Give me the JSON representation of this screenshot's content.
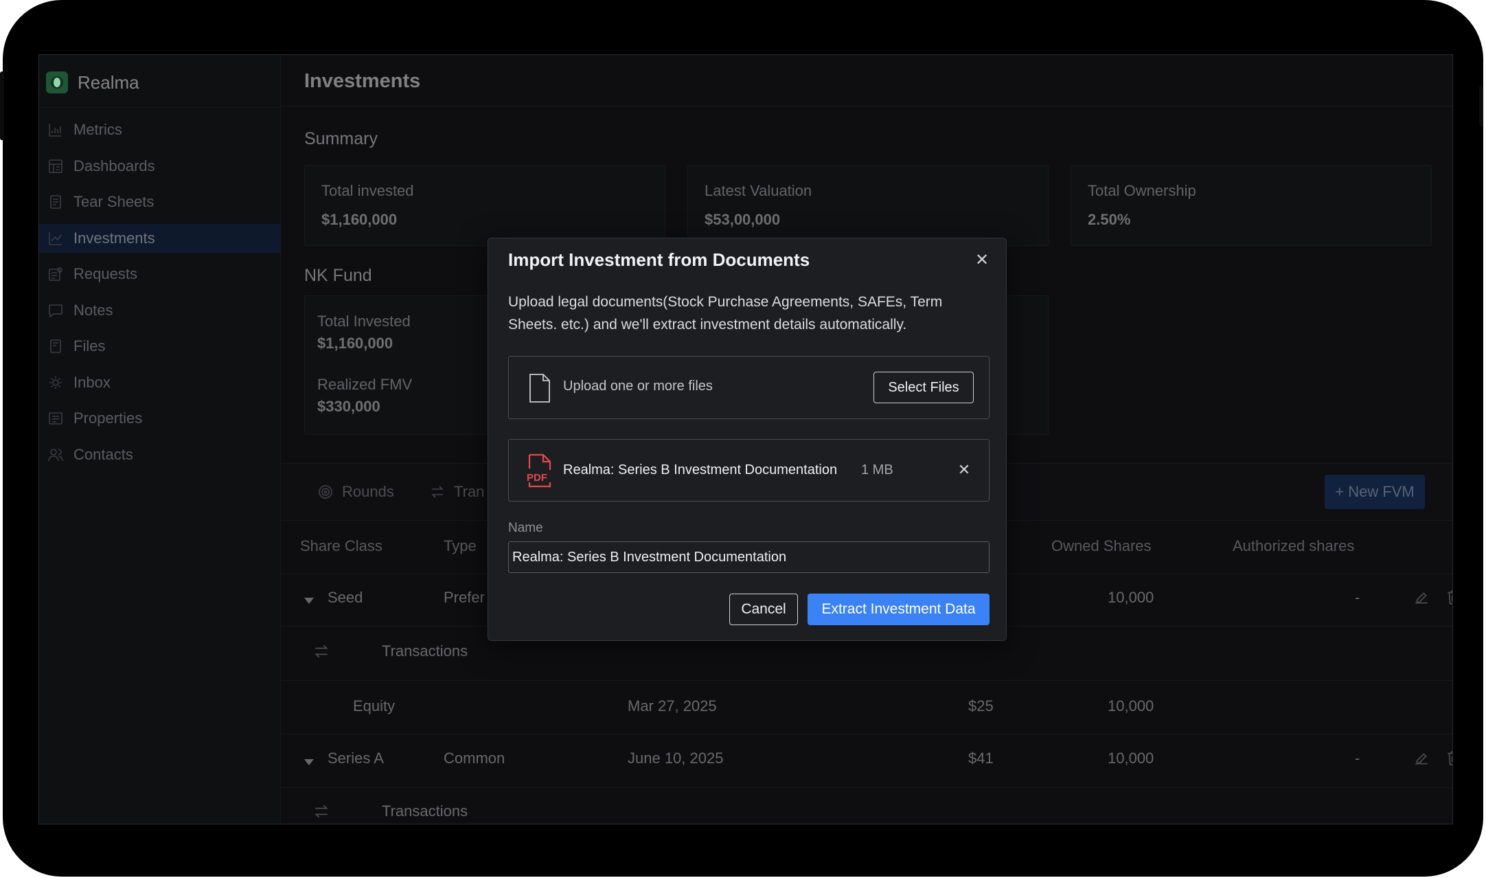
{
  "app": {
    "name": "Realma"
  },
  "sidebar": {
    "items": [
      {
        "label": "Metrics",
        "icon": "bar-chart-icon"
      },
      {
        "label": "Dashboards",
        "icon": "dashboard-icon"
      },
      {
        "label": "Tear Sheets",
        "icon": "document-icon"
      },
      {
        "label": "Investments",
        "icon": "line-chart-icon",
        "active": true
      },
      {
        "label": "Requests",
        "icon": "request-icon"
      },
      {
        "label": "Notes",
        "icon": "chat-bubble-icon"
      },
      {
        "label": "Files",
        "icon": "file-icon"
      },
      {
        "label": "Inbox",
        "icon": "inbox-icon"
      },
      {
        "label": "Properties",
        "icon": "list-icon"
      },
      {
        "label": "Contacts",
        "icon": "users-icon"
      }
    ]
  },
  "page": {
    "title": "Investments"
  },
  "summary": {
    "title": "Summary",
    "cards": [
      {
        "label": "Total invested",
        "value": "$1,160,000"
      },
      {
        "label": "Latest Valuation",
        "value": "$53,00,000"
      },
      {
        "label": "Total Ownership",
        "value": "2.50%"
      }
    ]
  },
  "fund": {
    "title": "NK Fund",
    "total_invested_label": "Total Invested",
    "total_invested_value": "$1,160,000",
    "realized_fmv_label": "Realized FMV",
    "realized_fmv_value": "$330,000"
  },
  "tabs": [
    {
      "label": "Rounds",
      "icon": "target-icon"
    },
    {
      "label": "Tran",
      "icon": "swap-icon"
    }
  ],
  "new_fvm_label": "+ New FVM",
  "table": {
    "headers": {
      "share_class": "Share Class",
      "type": "Type",
      "owned_shares": "Owned Shares",
      "authorized_shares": "Authorized shares"
    },
    "rows": [
      {
        "share_class": "Seed",
        "type": "Prefer",
        "owned_shares": "10,000",
        "authorized": "-"
      },
      {
        "transactions_label": "Transactions"
      },
      {
        "share_class": "Equity",
        "date": "Mar 27, 2025",
        "price": "$25",
        "owned_shares": "10,000"
      },
      {
        "share_class": "Series A",
        "type": "Common",
        "date": "June 10, 2025",
        "price": "$41",
        "owned_shares": "10,000",
        "authorized": "-"
      },
      {
        "transactions_label": "Transactions"
      }
    ]
  },
  "modal": {
    "title": "Import Investment from Documents",
    "description": "Upload legal documents(Stock Purchase Agreements, SAFEs, Term Sheets. etc.) and we'll extract investment details automatically.",
    "upload_text": "Upload one or more files",
    "select_files_label": "Select Files",
    "file": {
      "name": "Realma: Series B Investment Documentation",
      "size": "1 MB",
      "type_badge": "PDF"
    },
    "name_label": "Name",
    "name_value": "Realma: Series B Investment Documentation",
    "cancel_label": "Cancel",
    "extract_label": "Extract Investment Data"
  }
}
